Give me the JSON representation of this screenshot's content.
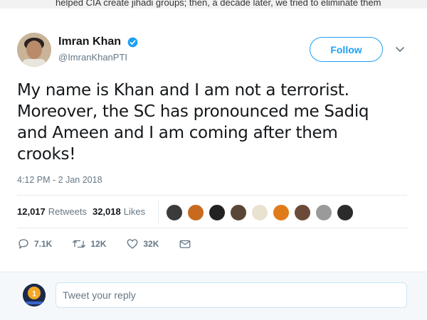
{
  "banner": {
    "text": "helped CIA create jihadi groups; then, a decade later, we tried to eliminate them"
  },
  "author": {
    "display_name": "Imran Khan",
    "handle": "@ImranKhanPTI",
    "verified": true
  },
  "follow_button": {
    "label": "Follow"
  },
  "tweet": {
    "text": "My name is Khan and I am not a terrorist. Moreover, the SC has pronounced me Sadiq and Ameen and I am coming after them crooks!",
    "timestamp": "4:12 PM - 2 Jan 2018"
  },
  "stats": {
    "retweets_count": "12,017",
    "retweets_label": "Retweets",
    "likes_count": "32,018",
    "likes_label": "Likes"
  },
  "actions": {
    "reply_count": "7.1K",
    "retweet_count": "12K",
    "like_count": "32K"
  },
  "reply": {
    "placeholder": "Tweet your reply",
    "avatar_badge": "1"
  },
  "colors": {
    "accent": "#1da1f2",
    "text": "#14171a",
    "muted": "#657786",
    "border": "#e6ecf0"
  },
  "icons": [
    "verified-badge-icon",
    "chevron-down-icon",
    "reply-icon",
    "retweet-icon",
    "heart-icon",
    "direct-message-icon"
  ]
}
